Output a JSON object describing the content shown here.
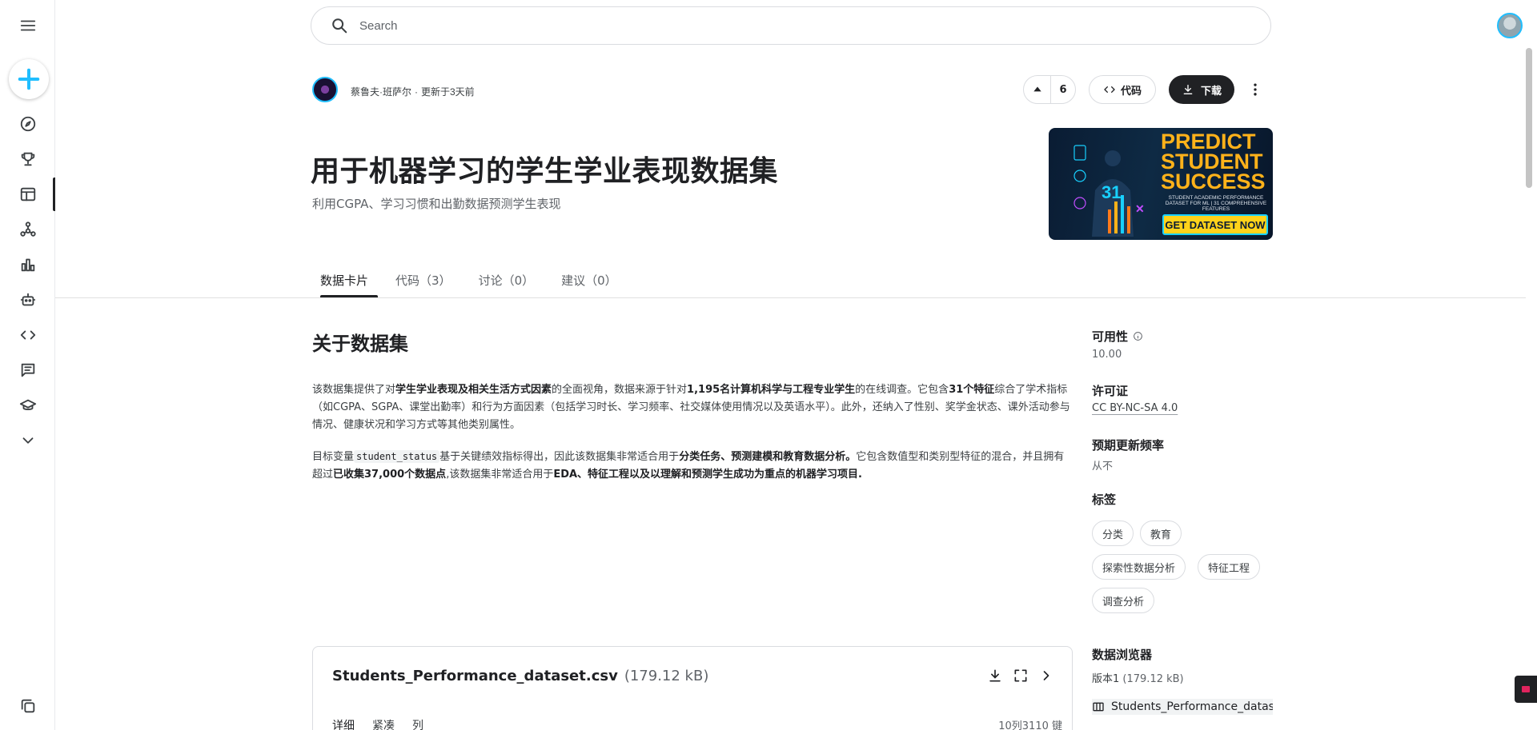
{
  "search": {
    "placeholder": "Search"
  },
  "owner": {
    "name": "蔡鲁夫·班萨尔",
    "updated": "更新于3天前"
  },
  "actions": {
    "vote_count": "6",
    "code_label": "代码",
    "download_label": "下载"
  },
  "dataset": {
    "title": "用于机器学习的学生学业表现数据集",
    "subtitle": "利用CGPA、学习习惯和出勤数据预测学生表现"
  },
  "banner": {
    "headline_1": "PREDICT",
    "headline_2": "STUDENT",
    "headline_3": "SUCCESS",
    "tagline": "STUDENT ACADEMIC PERFORMANCE DATASET FOR ML | 31 COMPREHENSIVE FEATURES",
    "cta": "GET DATASET NOW",
    "number": "31"
  },
  "tabs": [
    {
      "label": "数据卡片"
    },
    {
      "label": "代码（3）"
    },
    {
      "label": "讨论（0）"
    },
    {
      "label": "建议（0）"
    }
  ],
  "about": {
    "heading": "关于数据集",
    "p1": {
      "a": "该数据集提供了对",
      "b": "学生学业表现及相关生活方式因素",
      "c": "的全面视角，数据来源于针对",
      "d": "1,195名计算机科学与工程专业学生",
      "e": "的在线调查。它包含",
      "f": "31个特征",
      "g": "综合了学术指标（如CGPA、SGPA、课堂出勤率）和行为方面因素（包括学习时长、学习频率、社交媒体使用情况以及英语水平）。此外，还纳入了性别、奖学金状态、课外活动参与情况、健康状况和学习方式等其他类别属性。"
    },
    "p2": {
      "a": "目标变量",
      "code": "student_status",
      "b": "基于关键绩效指标得出，因此该数据集非常适合用于",
      "c": "分类任务、预测建模和教育数据分析。",
      "d": "它包含数值型和类别型特征的混合，并且拥有超过",
      "e": "已收集37,000个数据点",
      "f": ",该数据集非常适合用于",
      "g": "EDA、特征工程以及以理解和预测学生成功为重点的机器学习项目."
    }
  },
  "meta": {
    "usability_label": "可用性",
    "usability_value": "10.00",
    "license_label": "许可证",
    "license_value": "CC BY-NC-SA 4.0",
    "frequency_label": "预期更新频率",
    "frequency_value": "从不",
    "tags_label": "标签",
    "tags": [
      "分类",
      "教育",
      "探索性数据分析",
      "特征工程",
      "调查分析"
    ]
  },
  "file": {
    "name": "Students_Performance_dataset.csv",
    "size": "(179.12 kB)",
    "tabs": [
      "详细",
      "紧凑",
      "列"
    ],
    "columns_info": "10列3110 键"
  },
  "explorer": {
    "label": "数据浏览器",
    "version": "版本1",
    "version_size": "(179.12 kB)",
    "file": "Students_Performance_dataset.csv"
  }
}
